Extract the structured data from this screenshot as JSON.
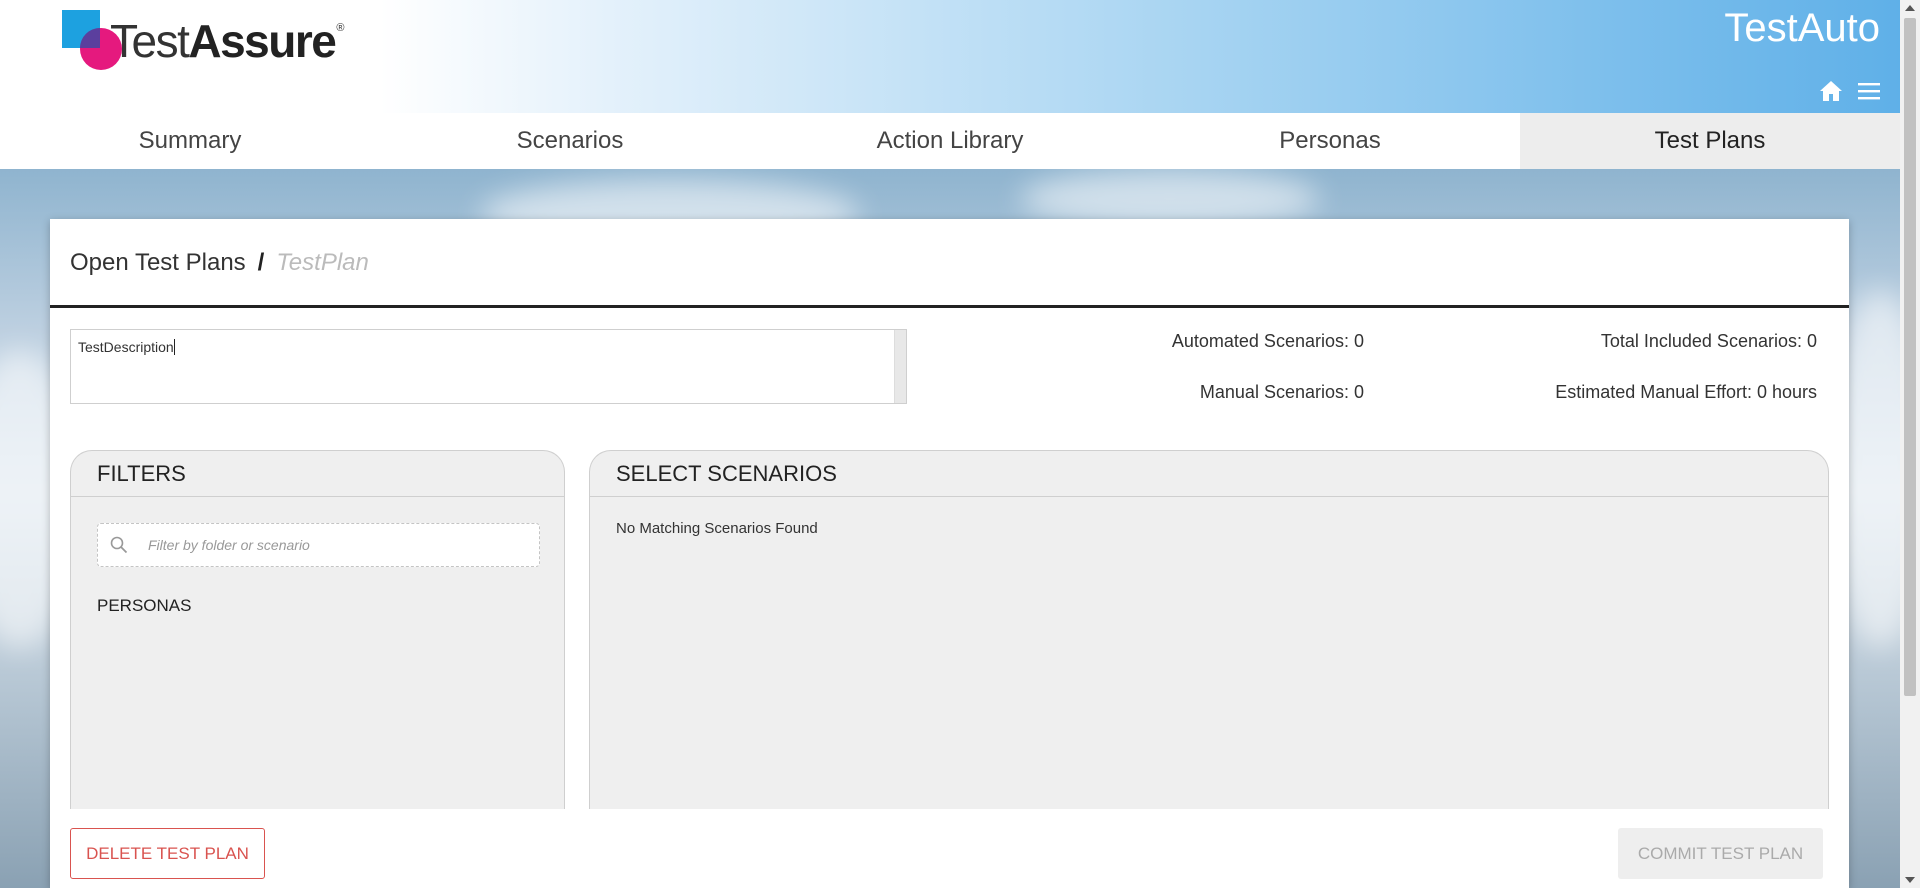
{
  "header": {
    "logo_text_light": "Test",
    "logo_text_bold": "Assure",
    "logo_reg": "®",
    "app_title": "TestAuto",
    "icons": [
      "home-icon",
      "hamburger-menu-icon"
    ]
  },
  "nav": {
    "tabs": [
      {
        "label": "Summary",
        "active": false
      },
      {
        "label": "Scenarios",
        "active": false
      },
      {
        "label": "Action Library",
        "active": false
      },
      {
        "label": "Personas",
        "active": false
      },
      {
        "label": "Test Plans",
        "active": true
      }
    ]
  },
  "breadcrumb": {
    "parent": "Open Test Plans",
    "separator": "/",
    "current": "TestPlan"
  },
  "description": {
    "value": "TestDescription"
  },
  "stats": {
    "automated": "Automated Scenarios: 0",
    "manual": "Manual Scenarios: 0",
    "total_included": "Total Included Scenarios: 0",
    "estimated_effort": "Estimated Manual Effort: 0 hours"
  },
  "filters": {
    "title": "FILTERS",
    "search_placeholder": "Filter by folder or scenario",
    "personas_label": "PERSONAS"
  },
  "scenarios": {
    "title": "SELECT SCENARIOS",
    "empty_message": "No Matching Scenarios Found"
  },
  "footer": {
    "delete_label": "DELETE TEST PLAN",
    "commit_label": "COMMIT TEST PLAN"
  },
  "colors": {
    "accent_blue": "#5fb0e8",
    "danger": "#d9534f",
    "active_tab_bg": "#ededed",
    "disabled_text": "#aaaaaa"
  }
}
